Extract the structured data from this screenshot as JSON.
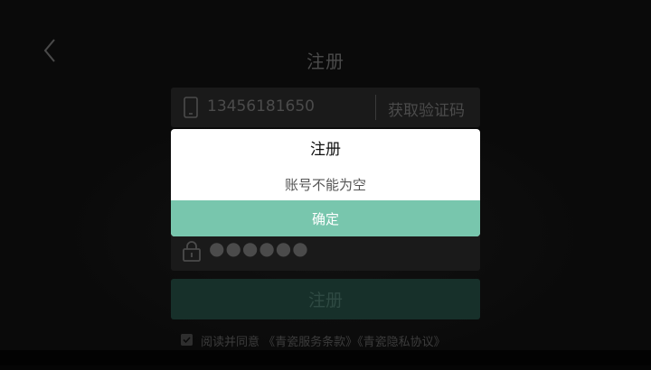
{
  "header": {
    "title": "注册"
  },
  "form": {
    "phone_value": "13456181650",
    "get_code_label": "获取验证码",
    "password_masked": "●●●●●●",
    "register_label": "注册"
  },
  "agreement": {
    "text": "阅读并同意 《青瓷服务条款》《青瓷隐私协议》",
    "checked": true
  },
  "dialog": {
    "title": "注册",
    "message": "账号不能为空",
    "confirm_label": "确定"
  },
  "colors": {
    "accent": "#78c6ad",
    "dim_button": "#17302a",
    "field_bg": "#1a1a1a"
  },
  "icons": {
    "back": "chevron-left-icon",
    "phone": "phone-icon",
    "lock": "lock-icon",
    "checkbox": "checkbox-icon"
  }
}
